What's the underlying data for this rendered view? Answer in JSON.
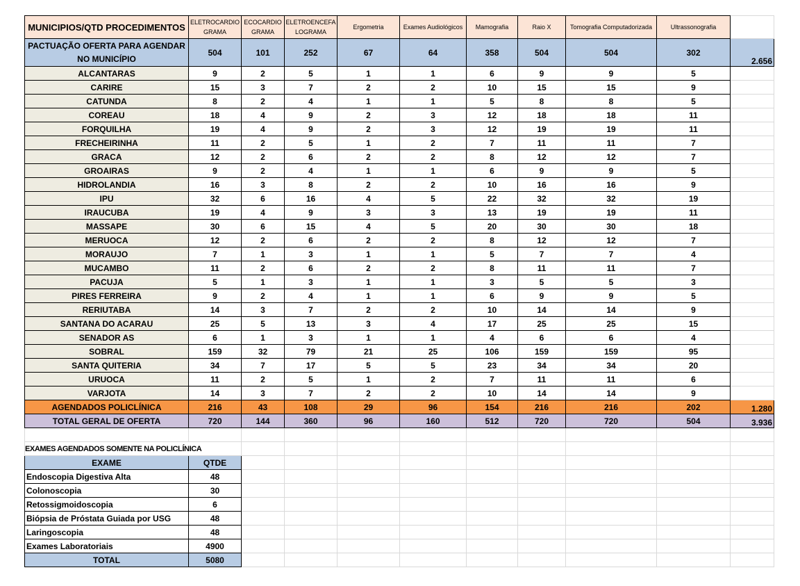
{
  "header": {
    "corner": "MUNICIPIOS/QTD PROCEDIMENTOS",
    "columns": [
      "ELETROCARDIO GRAMA",
      "ECOCARDIO GRAMA",
      "ELETROENCEFA LOGRAMA",
      "Ergometria",
      "Exames Audiológicos",
      "Mamografia",
      "Raio X",
      "Tomografia Computadorizada",
      "Ultrassonografia"
    ]
  },
  "pactuacao": {
    "label": "PACTUAÇÃO OFERTA PARA AGENDAR NO MUNICÍPIO",
    "values": [
      "504",
      "101",
      "252",
      "67",
      "64",
      "358",
      "504",
      "504",
      "302"
    ],
    "total": "2.656"
  },
  "municipios": [
    {
      "name": "ALCANTARAS",
      "values": [
        "9",
        "2",
        "5",
        "1",
        "1",
        "6",
        "9",
        "9",
        "5"
      ]
    },
    {
      "name": "CARIRE",
      "values": [
        "15",
        "3",
        "7",
        "2",
        "2",
        "10",
        "15",
        "15",
        "9"
      ]
    },
    {
      "name": "CATUNDA",
      "values": [
        "8",
        "2",
        "4",
        "1",
        "1",
        "5",
        "8",
        "8",
        "5"
      ]
    },
    {
      "name": "COREAU",
      "values": [
        "18",
        "4",
        "9",
        "2",
        "3",
        "12",
        "18",
        "18",
        "11"
      ]
    },
    {
      "name": "FORQUILHA",
      "values": [
        "19",
        "4",
        "9",
        "2",
        "3",
        "12",
        "19",
        "19",
        "11"
      ]
    },
    {
      "name": "FRECHEIRINHA",
      "values": [
        "11",
        "2",
        "5",
        "1",
        "2",
        "7",
        "11",
        "11",
        "7"
      ]
    },
    {
      "name": "GRACA",
      "values": [
        "12",
        "2",
        "6",
        "2",
        "2",
        "8",
        "12",
        "12",
        "7"
      ]
    },
    {
      "name": "GROAIRAS",
      "values": [
        "9",
        "2",
        "4",
        "1",
        "1",
        "6",
        "9",
        "9",
        "5"
      ]
    },
    {
      "name": "HIDROLANDIA",
      "values": [
        "16",
        "3",
        "8",
        "2",
        "2",
        "10",
        "16",
        "16",
        "9"
      ]
    },
    {
      "name": "IPU",
      "values": [
        "32",
        "6",
        "16",
        "4",
        "5",
        "22",
        "32",
        "32",
        "19"
      ]
    },
    {
      "name": "IRAUCUBA",
      "values": [
        "19",
        "4",
        "9",
        "3",
        "3",
        "13",
        "19",
        "19",
        "11"
      ]
    },
    {
      "name": "MASSAPE",
      "values": [
        "30",
        "6",
        "15",
        "4",
        "5",
        "20",
        "30",
        "30",
        "18"
      ]
    },
    {
      "name": "MERUOCA",
      "values": [
        "12",
        "2",
        "6",
        "2",
        "2",
        "8",
        "12",
        "12",
        "7"
      ]
    },
    {
      "name": "MORAUJO",
      "values": [
        "7",
        "1",
        "3",
        "1",
        "1",
        "5",
        "7",
        "7",
        "4"
      ]
    },
    {
      "name": "MUCAMBO",
      "values": [
        "11",
        "2",
        "6",
        "2",
        "2",
        "8",
        "11",
        "11",
        "7"
      ]
    },
    {
      "name": "PACUJA",
      "values": [
        "5",
        "1",
        "3",
        "1",
        "1",
        "3",
        "5",
        "5",
        "3"
      ]
    },
    {
      "name": "PIRES FERREIRA",
      "values": [
        "9",
        "2",
        "4",
        "1",
        "1",
        "6",
        "9",
        "9",
        "5"
      ]
    },
    {
      "name": "RERIUTABA",
      "values": [
        "14",
        "3",
        "7",
        "2",
        "2",
        "10",
        "14",
        "14",
        "9"
      ]
    },
    {
      "name": "SANTANA DO ACARAU",
      "values": [
        "25",
        "5",
        "13",
        "3",
        "4",
        "17",
        "25",
        "25",
        "15"
      ]
    },
    {
      "name": "SENADOR AS",
      "values": [
        "6",
        "1",
        "3",
        "1",
        "1",
        "4",
        "6",
        "6",
        "4"
      ]
    },
    {
      "name": "SOBRAL",
      "values": [
        "159",
        "32",
        "79",
        "21",
        "25",
        "106",
        "159",
        "159",
        "95"
      ]
    },
    {
      "name": "SANTA QUITERIA",
      "values": [
        "34",
        "7",
        "17",
        "5",
        "5",
        "23",
        "34",
        "34",
        "20"
      ]
    },
    {
      "name": "URUOCA",
      "values": [
        "11",
        "2",
        "5",
        "1",
        "2",
        "7",
        "11",
        "11",
        "6"
      ]
    },
    {
      "name": "VARJOTA",
      "values": [
        "14",
        "3",
        "7",
        "2",
        "2",
        "10",
        "14",
        "14",
        "9"
      ]
    }
  ],
  "agendados": {
    "label": "AGENDADOS POLICLÍNICA",
    "values": [
      "216",
      "43",
      "108",
      "29",
      "96",
      "154",
      "216",
      "216",
      "202"
    ],
    "total": "1.280"
  },
  "total_geral": {
    "label": "TOTAL GERAL DE OFERTA",
    "values": [
      "720",
      "144",
      "360",
      "96",
      "160",
      "512",
      "720",
      "720",
      "504"
    ],
    "total": "3.936"
  },
  "exames": {
    "title": "EXAMES AGENDADOS SOMENTE NA POLICLÍNICA",
    "col_exame": "EXAME",
    "col_qtde": "QTDE",
    "rows": [
      {
        "name": "Endoscopia Digestiva Alta",
        "qtde": "48"
      },
      {
        "name": "Colonoscopia",
        "qtde": "30"
      },
      {
        "name": "Retossigmoidoscopia",
        "qtde": "6"
      },
      {
        "name": "Biópsia de Próstata Guiada por USG",
        "qtde": "48"
      },
      {
        "name": "Laringoscopia",
        "qtde": "48"
      },
      {
        "name": "Exames Laboratoriais",
        "qtde": "4900"
      }
    ],
    "total_label": "TOTAL",
    "total_value": "5080"
  }
}
